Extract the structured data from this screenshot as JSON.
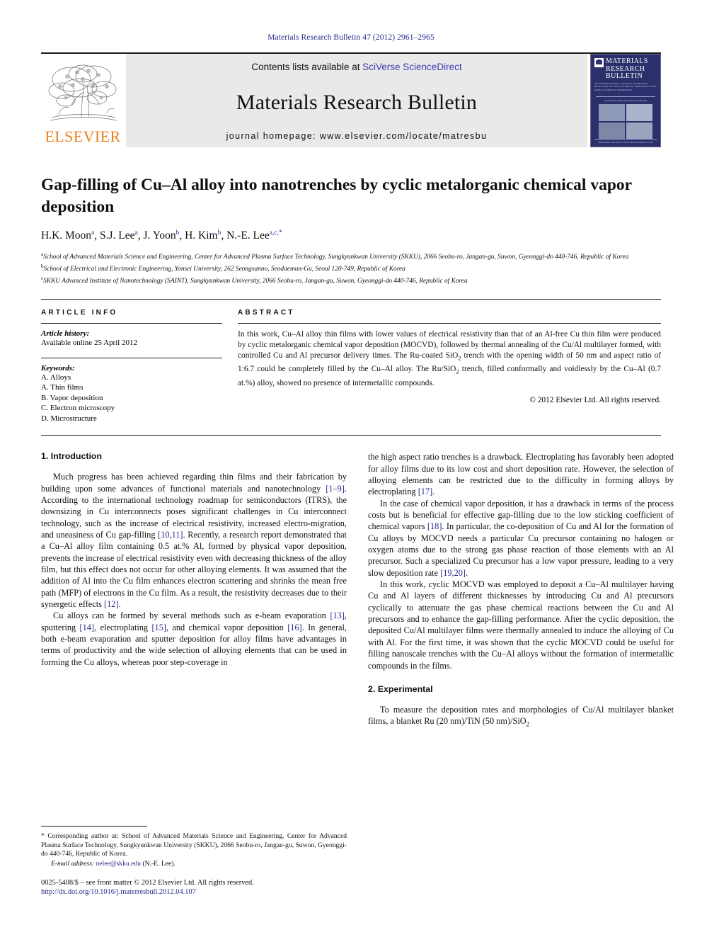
{
  "running_head": "Materials Research Bulletin 47 (2012) 2961–2965",
  "masthead": {
    "publisher_logo_label": "ELSEVIER",
    "contents_prefix": "Contents lists available at ",
    "contents_link": "SciVerse ScienceDirect",
    "journal_name": "Materials Research Bulletin",
    "homepage": "journal homepage: www.elsevier.com/locate/matresbu",
    "cover": {
      "title_line1": "MATERIALS",
      "title_line2": "RESEARCH",
      "title_line3": "BULLETIN",
      "subtitle": "AN INTERNATIONAL JOURNAL REPORTING RESEARCH ON THE SYNTHESIS, PROPERTIES AND APPLICATIONS OF MATERIALS",
      "caption": "Special issue: Advances in functional materials",
      "footer": "AVAILABLE ONLINE AT WWW.SCIENCEDIRECT.COM"
    }
  },
  "article": {
    "title": "Gap-filling of Cu–Al alloy into nanotrenches by cyclic metalorganic chemical vapor deposition",
    "authors": [
      {
        "name": "H.K. Moon",
        "sup": "a"
      },
      {
        "name": "S.J. Lee",
        "sup": "a"
      },
      {
        "name": "J. Yoon",
        "sup": "b"
      },
      {
        "name": "H. Kim",
        "sup": "b"
      },
      {
        "name": "N.-E. Lee",
        "sup": "a,c,*"
      }
    ],
    "affiliations": [
      {
        "marker": "a",
        "text": "School of Advanced Materials Science and Engineering, Center for Advanced Plasma Surface Technology, Sungkyunkwan University (SKKU), 2066 Seobu-ro, Jangan-gu, Suwon, Gyeonggi-do 440-746, Republic of Korea"
      },
      {
        "marker": "b",
        "text": "School of Electrical and Electronic Engineering, Yonsei University, 262 Seongsanno, Seodaemun-Gu, Seoul 120-749, Republic of Korea"
      },
      {
        "marker": "c",
        "text": "SKKU Advanced Institute of Nanotechnology (SAINT), Sungkyunkwan University, 2066 Seobu-ro, Jangan-gu, Suwon, Gyeonggi-do 440-746, Republic of Korea"
      }
    ]
  },
  "article_info": {
    "heading": "ARTICLE INFO",
    "history_label": "Article history:",
    "history_value": "Available online 25 April 2012",
    "keywords_label": "Keywords:",
    "keywords": [
      "A. Alloys",
      "A. Thin films",
      "B. Vapor deposition",
      "C. Electron microscopy",
      "D. Microstructure"
    ]
  },
  "abstract": {
    "heading": "ABSTRACT",
    "copyright": "© 2012 Elsevier Ltd. All rights reserved."
  },
  "sections": {
    "introduction_heading": "1. Introduction",
    "experimental_heading": "2. Experimental"
  },
  "footnote": {
    "corresponding": "* Corresponding author at: School of Advanced Materials Science and Engineering, Center for Advanced Plasma Surface Technology, Sungkyunkwan University (SKKU), 2066 Seobu-ro, Jangan-gu, Suwon, Gyeonggi-do 440-746, Republic of Korea.",
    "email_label": "E-mail address:",
    "email": "nelee@skku.edu",
    "email_suffix": "(N.-E. Lee).",
    "issn": "0025-5408/$ – see front matter © 2012 Elsevier Ltd. All rights reserved.",
    "doi": "http://dx.doi.org/10.1016/j.materresbull.2012.04.107"
  },
  "colors": {
    "link": "#27298a",
    "elsevier_orange": "#f07f1a",
    "masthead_grey": "#e9e9e9",
    "cover_navy": "#2b2f6b"
  }
}
